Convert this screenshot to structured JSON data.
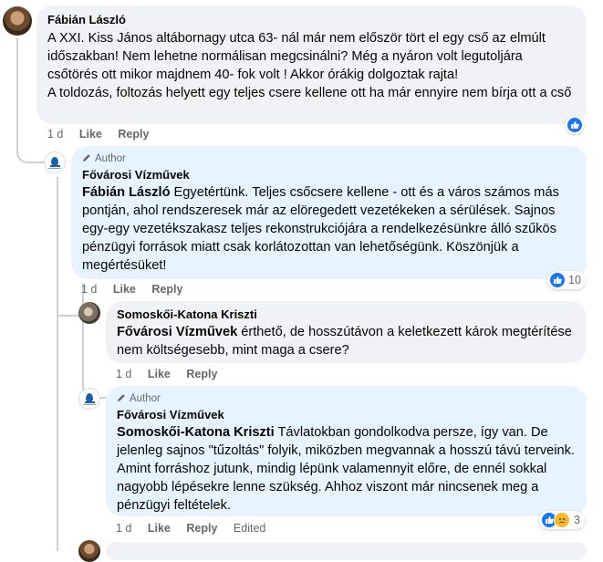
{
  "comments": [
    {
      "name": "Fábián László",
      "text": "A XXI. Kiss János altábornagy utca 63- nál már nem először tört el egy cső az elmúlt időszakban! Nem lehetne normálisan megcsinálni? Még a nyáron volt legutoljára csőtörés ott mikor majdnem 40- fok volt ! Akkor órákig dolgoztak rajta!\nA toldozás, foltozás helyett egy teljes csere kellene ott ha már ennyire nem bírja ott a cső",
      "time": "1 d",
      "like": "Like",
      "reply": "Reply",
      "reactions": {
        "types": [
          "like-icon"
        ],
        "count": ""
      }
    },
    {
      "author_label": "Author",
      "name": "Fővárosi Vízművek",
      "mention": "Fábián László",
      "text": " Egyetértünk. Teljes csőcsere kellene - ott és a város számos más pontján, ahol rendszeresek már az elöregedett vezetékeken a sérülések. Sajnos egy-egy vezetékszakasz teljes rekonstrukciójára a rendelkezésünkre álló szűkös pénzügyi források miatt csak korlátozottan van lehetőségünk. Köszönjük a megértésüket!",
      "time": "1 d",
      "like": "Like",
      "reply": "Reply",
      "reactions": {
        "types": [
          "like-icon"
        ],
        "count": "10"
      }
    },
    {
      "name": "Somoskői-Katona Kriszti",
      "mention": "Fővárosi Vízművek",
      "text": " érthető, de hosszútávon a keletkezett károk megtérítése nem költségesebb, mint maga a csere?",
      "time": "1 d",
      "like": "Like",
      "reply": "Reply"
    },
    {
      "author_label": "Author",
      "name": "Fővárosi Vízművek",
      "mention": "Somoskői-Katona Kriszti",
      "text": " Távlatokban gondolkodva persze, így van. De jelenleg sajnos \"tűzoltás\" folyik, miközben megvannak a hosszú távú terveink. Amint forráshoz jutunk, mindig lépünk valamennyit előre, de ennél sokkal nagyobb lépésekre lenne szükség. Ahhoz viszont már nincsenek meg a pénzügyi feltételek.",
      "time": "1 d",
      "like": "Like",
      "reply": "Reply",
      "edited": "Edited",
      "reactions": {
        "types": [
          "like-icon",
          "sad-icon"
        ],
        "count": "3"
      }
    }
  ],
  "colors": {
    "author_bubble": "#e7f3ff",
    "bubble": "#f0f2f5",
    "like_blue": "#1877f2",
    "sad_yellow": "#f7b928"
  }
}
